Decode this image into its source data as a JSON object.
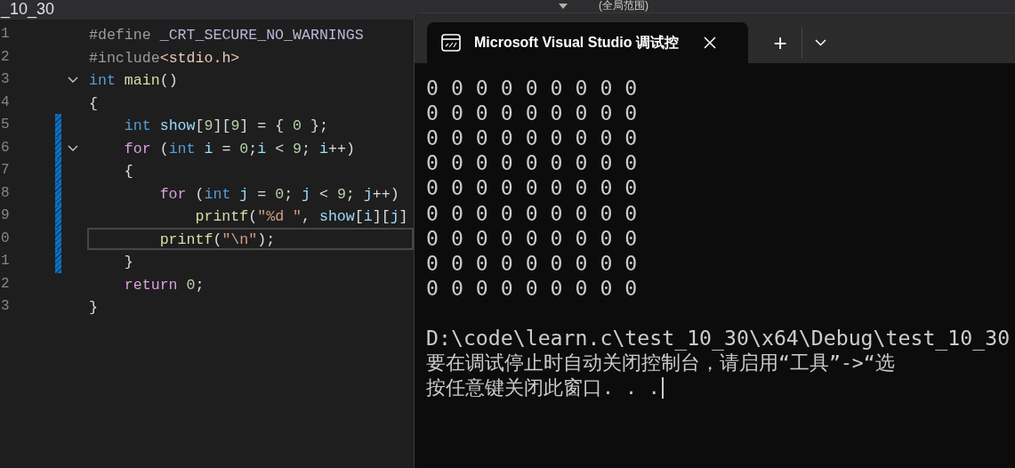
{
  "editor": {
    "file_tab": "_10_30",
    "scope_dropdown": "(全局范围)",
    "lines": [
      {
        "number": "1",
        "changed": false,
        "fold": false,
        "current": false,
        "tokens": [
          {
            "text": "#define ",
            "kind": "preproc"
          },
          {
            "text": "_CRT_SECURE_NO_WARNINGS",
            "kind": "macro"
          }
        ]
      },
      {
        "number": "2",
        "changed": false,
        "fold": false,
        "current": false,
        "tokens": [
          {
            "text": "#include",
            "kind": "preproc"
          },
          {
            "text": "<stdio.h>",
            "kind": "path"
          }
        ]
      },
      {
        "number": "3",
        "changed": false,
        "fold": true,
        "current": false,
        "tokens": [
          {
            "text": "int ",
            "kind": "type"
          },
          {
            "text": "main",
            "kind": "func"
          },
          {
            "text": "()",
            "kind": "plain"
          }
        ]
      },
      {
        "number": "4",
        "changed": false,
        "fold": false,
        "current": false,
        "tokens": [
          {
            "text": "{",
            "kind": "plain"
          }
        ]
      },
      {
        "number": "5",
        "changed": true,
        "fold": false,
        "current": false,
        "tokens": [
          {
            "text": "    int ",
            "kind": "type"
          },
          {
            "text": "show",
            "kind": "var"
          },
          {
            "text": "[",
            "kind": "plain"
          },
          {
            "text": "9",
            "kind": "number"
          },
          {
            "text": "][",
            "kind": "plain"
          },
          {
            "text": "9",
            "kind": "number"
          },
          {
            "text": "] = { ",
            "kind": "plain"
          },
          {
            "text": "0",
            "kind": "number"
          },
          {
            "text": " };",
            "kind": "plain"
          }
        ]
      },
      {
        "number": "6",
        "changed": true,
        "fold": true,
        "current": false,
        "tokens": [
          {
            "text": "    for",
            "kind": "control"
          },
          {
            "text": " (",
            "kind": "plain"
          },
          {
            "text": "int ",
            "kind": "type"
          },
          {
            "text": "i",
            "kind": "var"
          },
          {
            "text": " = ",
            "kind": "plain"
          },
          {
            "text": "0",
            "kind": "number"
          },
          {
            "text": ";",
            "kind": "plain"
          },
          {
            "text": "i",
            "kind": "var"
          },
          {
            "text": " < ",
            "kind": "plain"
          },
          {
            "text": "9",
            "kind": "number"
          },
          {
            "text": "; ",
            "kind": "plain"
          },
          {
            "text": "i",
            "kind": "var"
          },
          {
            "text": "++)",
            "kind": "plain"
          }
        ]
      },
      {
        "number": "7",
        "changed": true,
        "fold": false,
        "current": false,
        "tokens": [
          {
            "text": "    {",
            "kind": "plain"
          }
        ]
      },
      {
        "number": "8",
        "changed": true,
        "fold": false,
        "current": false,
        "tokens": [
          {
            "text": "        for",
            "kind": "control"
          },
          {
            "text": " (",
            "kind": "plain"
          },
          {
            "text": "int ",
            "kind": "type"
          },
          {
            "text": "j",
            "kind": "var"
          },
          {
            "text": " = ",
            "kind": "plain"
          },
          {
            "text": "0",
            "kind": "number"
          },
          {
            "text": "; ",
            "kind": "plain"
          },
          {
            "text": "j",
            "kind": "var"
          },
          {
            "text": " < ",
            "kind": "plain"
          },
          {
            "text": "9",
            "kind": "number"
          },
          {
            "text": "; ",
            "kind": "plain"
          },
          {
            "text": "j",
            "kind": "var"
          },
          {
            "text": "++)",
            "kind": "plain"
          }
        ]
      },
      {
        "number": "9",
        "changed": true,
        "fold": false,
        "current": false,
        "tokens": [
          {
            "text": "            printf",
            "kind": "func"
          },
          {
            "text": "(",
            "kind": "plain"
          },
          {
            "text": "\"%d \"",
            "kind": "string"
          },
          {
            "text": ", ",
            "kind": "plain"
          },
          {
            "text": "show",
            "kind": "var"
          },
          {
            "text": "[",
            "kind": "plain"
          },
          {
            "text": "i",
            "kind": "var"
          },
          {
            "text": "][",
            "kind": "plain"
          },
          {
            "text": "j",
            "kind": "var"
          },
          {
            "text": "]",
            "kind": "plain"
          }
        ]
      },
      {
        "number": "0",
        "changed": true,
        "fold": false,
        "current": true,
        "tokens": [
          {
            "text": "        printf",
            "kind": "func"
          },
          {
            "text": "(",
            "kind": "plain"
          },
          {
            "text": "\"\\n\"",
            "kind": "string"
          },
          {
            "text": ");",
            "kind": "plain"
          }
        ]
      },
      {
        "number": "1",
        "changed": true,
        "fold": false,
        "current": false,
        "tokens": [
          {
            "text": "    }",
            "kind": "plain"
          }
        ]
      },
      {
        "number": "2",
        "changed": false,
        "fold": false,
        "current": false,
        "tokens": [
          {
            "text": "    return ",
            "kind": "control"
          },
          {
            "text": "0",
            "kind": "number"
          },
          {
            "text": ";",
            "kind": "plain"
          }
        ]
      },
      {
        "number": "3",
        "changed": false,
        "fold": false,
        "current": false,
        "tokens": [
          {
            "text": "}",
            "kind": "plain"
          }
        ]
      }
    ]
  },
  "terminal": {
    "tab_title": "Microsoft Visual Studio 调试控",
    "new_tab": "+",
    "output": [
      "0 0 0 0 0 0 0 0 0",
      "0 0 0 0 0 0 0 0 0",
      "0 0 0 0 0 0 0 0 0",
      "0 0 0 0 0 0 0 0 0",
      "0 0 0 0 0 0 0 0 0",
      "0 0 0 0 0 0 0 0 0",
      "0 0 0 0 0 0 0 0 0",
      "0 0 0 0 0 0 0 0 0",
      "0 0 0 0 0 0 0 0 0"
    ],
    "messages": [
      "D:\\code\\learn.c\\test_10_30\\x64\\Debug\\test_10_30",
      "要在调试停止时自动关闭控制台，请启用“工具”->“选",
      "按任意键关闭此窗口. . ."
    ]
  }
}
